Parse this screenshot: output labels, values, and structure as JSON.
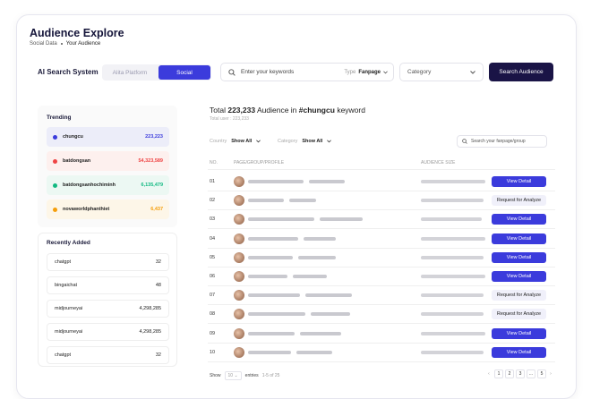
{
  "header": {
    "title": "Audience Explore",
    "breadcrumb": [
      "Social Data",
      "Your Audience"
    ]
  },
  "toolbar": {
    "system_label": "AI Search System",
    "platform_tab": "Alita Platform",
    "social_tab": "Social",
    "search_placeholder": "Enter your keywords",
    "type_label": "Type",
    "type_value": "Fanpage",
    "category_placeholder": "Category",
    "search_button": "Search Audience"
  },
  "trending": {
    "title": "Trending",
    "items": [
      {
        "name": "chungcu",
        "count": "223,223",
        "color": "#3b3bdc",
        "bg": "#ecedf9"
      },
      {
        "name": "batdongsan",
        "count": "54,323,589",
        "color": "#ef4444",
        "bg": "#fdf0ee"
      },
      {
        "name": "batdongsanhochiminh",
        "count": "6,135,479",
        "color": "#10b981",
        "bg": "#ecf8f3"
      },
      {
        "name": "novaworldphanthiet",
        "count": "6,437",
        "color": "#f59e0b",
        "bg": "#fdf6e8"
      }
    ]
  },
  "recent": {
    "title": "Recently Added",
    "items": [
      {
        "name": "chatgpt",
        "count": "32"
      },
      {
        "name": "bingaichat",
        "count": "48"
      },
      {
        "name": "midjourneyai",
        "count": "4,298,285"
      },
      {
        "name": "midjourneyai",
        "count": "4,298,285"
      },
      {
        "name": "chatgpt",
        "count": "32"
      }
    ]
  },
  "main": {
    "total_prefix": "Total",
    "total_count": "223,233",
    "total_mid": "Audience in",
    "total_tag": "#chungcu",
    "total_suffix": "keyword",
    "total_sub": "Total user : 223,233",
    "country_label": "Country",
    "country_value": "Show All",
    "category_label": "Category",
    "category_value": "Show All",
    "group_search_placeholder": "Search your fanpage/group",
    "columns": [
      "NO.",
      "PAGE/GROUP/PROFILE",
      "AUDIENCE SIZE"
    ],
    "rows": [
      {
        "no": "01",
        "action": "View Detail",
        "kind": "v"
      },
      {
        "no": "02",
        "action": "Request for Analyze",
        "kind": "r"
      },
      {
        "no": "03",
        "action": "View Detail",
        "kind": "v"
      },
      {
        "no": "04",
        "action": "View Detail",
        "kind": "v"
      },
      {
        "no": "05",
        "action": "View Detail",
        "kind": "v"
      },
      {
        "no": "06",
        "action": "View Detail",
        "kind": "v"
      },
      {
        "no": "07",
        "action": "Request for Analyze",
        "kind": "r"
      },
      {
        "no": "08",
        "action": "Request for Analyze",
        "kind": "r"
      },
      {
        "no": "09",
        "action": "View Detail",
        "kind": "v"
      },
      {
        "no": "10",
        "action": "View Detail",
        "kind": "v"
      }
    ]
  },
  "footer": {
    "show_label": "Show",
    "page_size": "10",
    "entries_label": "entries",
    "range": "1-5 of 25",
    "pages": [
      "1",
      "2",
      "3",
      "...",
      "5"
    ]
  }
}
